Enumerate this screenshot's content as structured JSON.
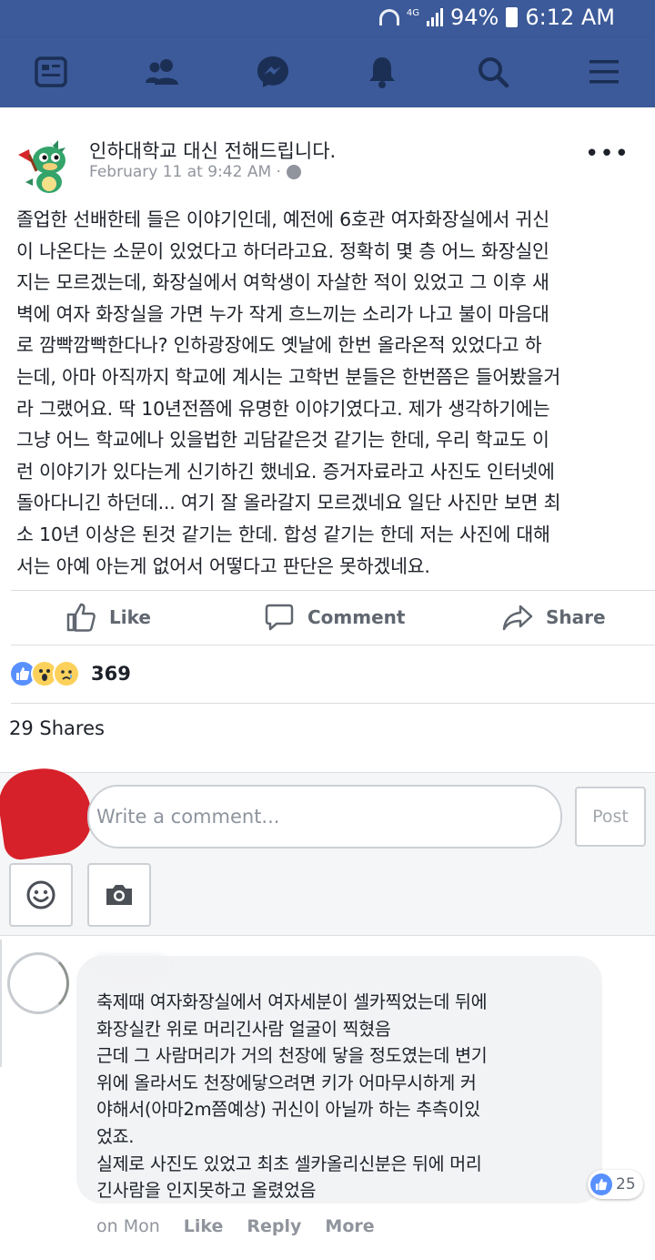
{
  "status_bar": {
    "network": "4G",
    "battery": "94%",
    "time": "6:12 AM"
  },
  "nav": {
    "icons": [
      "news-feed-icon",
      "friends-icon",
      "messenger-icon",
      "notifications-icon",
      "search-icon",
      "menu-icon"
    ]
  },
  "post": {
    "page_name": "인하대학교 대신 전해드립니다.",
    "time": "February 11 at 9:42 AM ·",
    "body_lines": [
      "졸업한 선배한테 들은 이야기인데, 예전에 6호관 여자화장실에서 귀신",
      "이 나온다는 소문이 있었다고 하더라고요. 정확히 몇 층 어느 화장실인",
      "지는 모르겠는데, 화장실에서 여학생이 자살한 적이 있었고 그 이후 새",
      "벽에 여자 화장실을 가면 누가 작게 흐느끼는 소리가 나고 불이 마음대",
      "로 깜빡깜빡한다나? 인하광장에도 옛날에 한번 올라온적 있었다고 하",
      "는데, 아마 아직까지 학교에 계시는 고학번 분들은 한번쯤은 들어봤을거",
      "라 그랬어요. 딱 10년전쯤에 유명한 이야기였다고. 제가 생각하기에는",
      "그냥 어느 학교에나 있을법한 괴담같은것 같기는 한데, 우리 학교도 이",
      "런 이야기가 있다는게 신기하긴 했네요. 증거자료라고 사진도 인터넷에",
      "돌아다니긴 하던데... 여기 잘 올라갈지 모르겠네요 일단 사진만 보면 최",
      "소 10년 이상은 된것 같기는 한데. 합성 같기는 한데 저는 사진에 대해",
      "서는 아예 아는게 없어서 어떻다고 판단은 못하겠네요."
    ],
    "actions": {
      "like": "Like",
      "comment": "Comment",
      "share": "Share"
    },
    "reaction_count": "369",
    "shares": "29 Shares"
  },
  "composer": {
    "placeholder": "Write a comment...",
    "post_label": "Post"
  },
  "comment": {
    "text_lines": [
      "축제때 여자화장실에서 여자세분이 셀카찍었는데 뒤에",
      "화장실칸 위로 머리긴사람 얼굴이 찍혔음",
      "근데 그 사람머리가 거의 천장에 닿을 정도였는데 변기",
      "위에 올라서도 천장에닿으려면 키가 어마무시하게 커",
      "야해서(아마2m쯤예상) 귀신이 아닐까 하는 추측이있",
      "었죠.",
      "실제로 사진도 있었고 최초 셀카올리신분은 뒤에 머리",
      "긴사람을 인지못하고 올렸었음"
    ],
    "reaction_count": "25",
    "time": "on Mon",
    "like": "Like",
    "reply": "Reply",
    "more": "More"
  },
  "colors": {
    "facebook_blue": "#3c5a99",
    "like_blue": "#5890ff",
    "text": "#1d2129",
    "muted": "#90949c"
  }
}
